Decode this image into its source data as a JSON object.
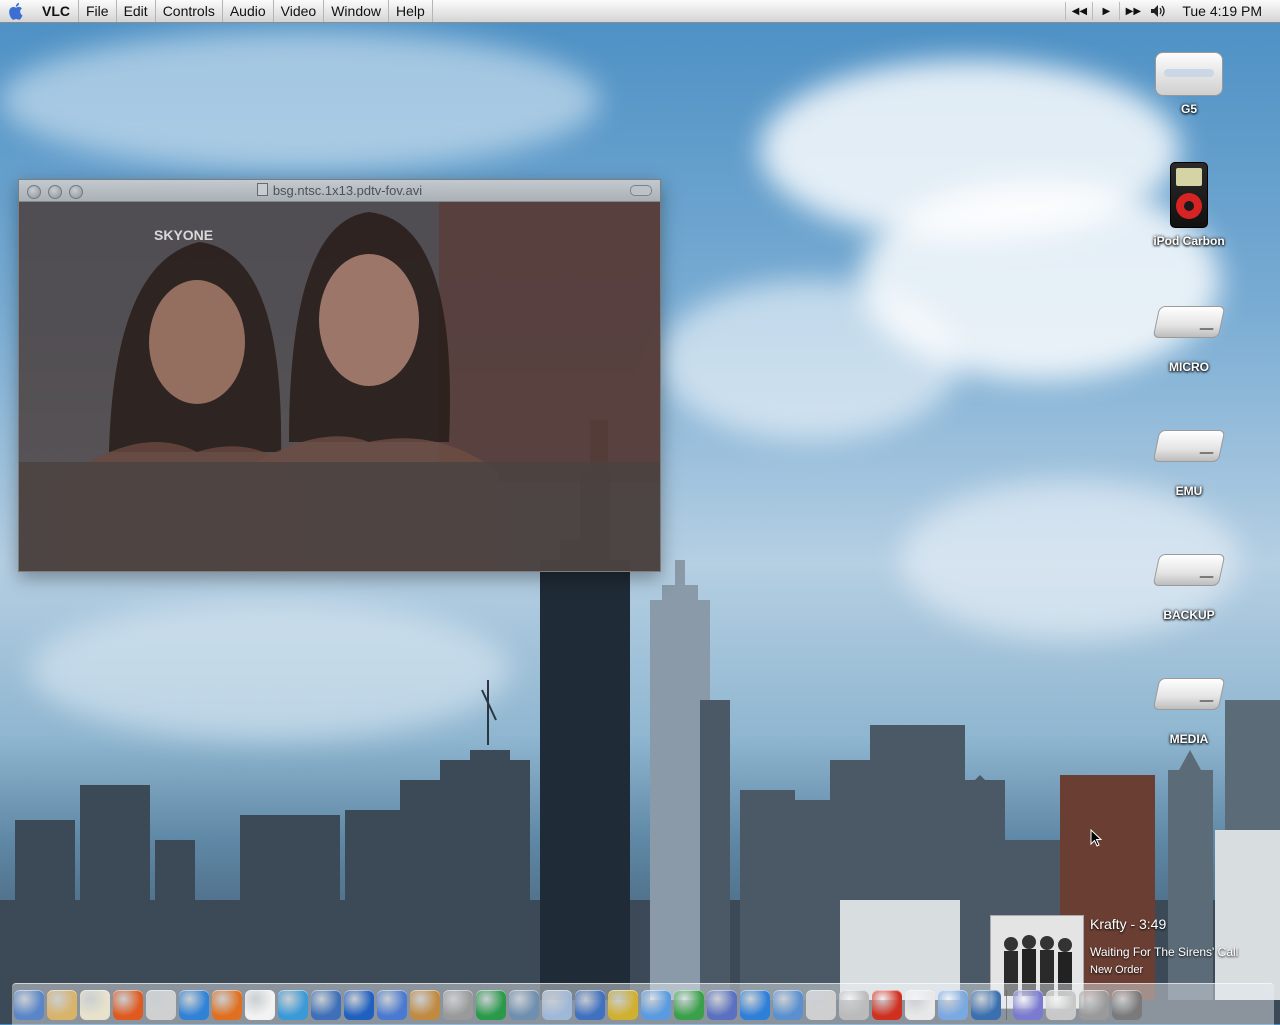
{
  "menubar": {
    "app_name": "VLC",
    "items": [
      "File",
      "Edit",
      "Controls",
      "Audio",
      "Video",
      "Window",
      "Help"
    ],
    "clock": "Tue 4:19 PM"
  },
  "desktop_icons": [
    {
      "label": "G5",
      "kind": "mac-mini-icon"
    },
    {
      "label": "iPod Carbon",
      "kind": "ipod-icon"
    },
    {
      "label": "MICRO",
      "kind": "drive-icon"
    },
    {
      "label": "EMU",
      "kind": "drive-icon"
    },
    {
      "label": "BACKUP",
      "kind": "drive-icon"
    },
    {
      "label": "MEDIA",
      "kind": "drive-icon"
    }
  ],
  "vlc_window": {
    "title": "bsg.ntsc.1x13.pdtv-fov.avi",
    "video_watermark": "SKYONE"
  },
  "now_playing": {
    "track": "Krafty - 3:49",
    "album": "Waiting For The Sirens' Call",
    "artist": "New Order"
  },
  "dock_colors": [
    "#5a86c8",
    "#d8b36a",
    "#e8e2cc",
    "#e05a20",
    "#d0d0d0",
    "#2f82d6",
    "#e07020",
    "#f2f2f2",
    "#3a9ad8",
    "#3e6fb8",
    "#2060c0",
    "#4a7ad0",
    "#c08a40",
    "#9a9a9a",
    "#2a9a4a",
    "#6f8fb0",
    "#9fb8d8",
    "#4070c0",
    "#d0b030",
    "#5a9ae0",
    "#3aa04a",
    "#5a70c0",
    "#2e7fd8",
    "#5a90d0",
    "#cfcfcf",
    "#bbbbbb",
    "#d03020",
    "#e8e8e8",
    "#7aa8e0",
    "#3a6fb0",
    "#7a7ad0",
    "#c8c8c8",
    "#9a9a9a",
    "#7a7a7a"
  ]
}
